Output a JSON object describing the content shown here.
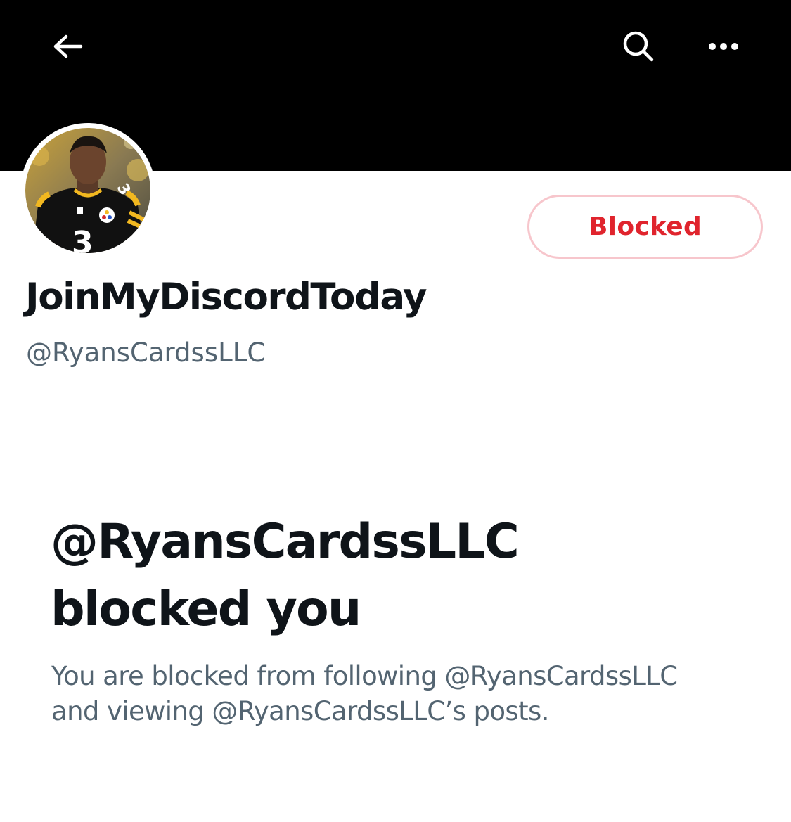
{
  "header": {
    "back_icon": "arrow-left-icon",
    "search_icon": "search-icon",
    "more_icon": "more-horizontal-icon",
    "banner_color": "#000000"
  },
  "profile": {
    "display_name": "JoinMyDiscordToday",
    "handle": "@RyansCardssLLC",
    "blocked_button_label": "Blocked",
    "blocked_button_color": "#e0242d"
  },
  "blocked_notice": {
    "title_line1": "@RyansCardssLLC",
    "title_line2": "blocked you",
    "description_line1": "You are blocked from following @RyansCardssLLC",
    "description_line2": "and viewing @RyansCardssLLC’s posts."
  }
}
